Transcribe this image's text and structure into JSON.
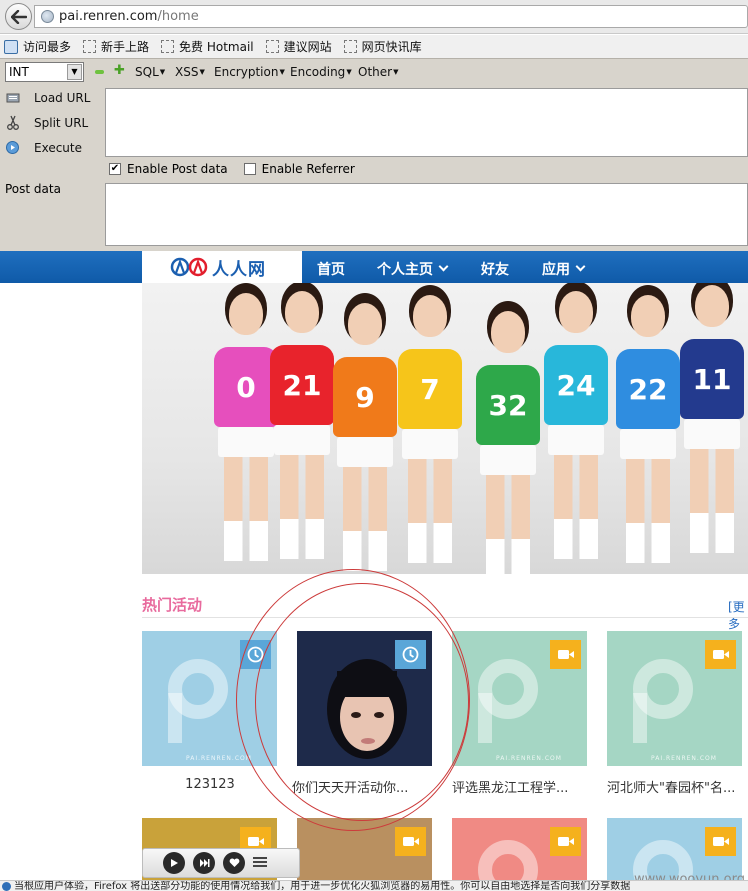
{
  "browser": {
    "url_host": "pai.renren.com",
    "url_path": "/home",
    "bookmarks": [
      "访问最多",
      "新手上路",
      "免费 Hotmail",
      "建议网站",
      "网页快讯库"
    ]
  },
  "hackbar": {
    "type_select": "INT",
    "menus": [
      "SQL",
      "XSS",
      "Encryption",
      "Encoding",
      "Other"
    ],
    "load_url": "Load URL",
    "split_url": "Split URL",
    "execute": "Execute",
    "enable_post": "Enable Post data",
    "enable_referrer": "Enable Referrer",
    "post_label": "Post data"
  },
  "renren": {
    "logo_text": "人人网",
    "nav": [
      "首页",
      "个人主页",
      "好友",
      "应用"
    ],
    "section_title": "热门活动",
    "more": "[更多",
    "cards": [
      {
        "label": "123123",
        "badge": "clock-icon",
        "color": "#9fcfe5"
      },
      {
        "label": "你们天天开活动你...",
        "badge": "clock-icon",
        "color": "#1e2a4a"
      },
      {
        "label": "评选黑龙江工程学...",
        "badge": "video-icon",
        "color": "#a5d6c4"
      },
      {
        "label": "河北师大\"春园杯\"名...",
        "badge": "video-icon",
        "color": "#a5d6c4"
      }
    ],
    "row2_colors": [
      "#c9a23a",
      "#b99060",
      "#f08a84",
      "#9fcfe5"
    ],
    "girls": [
      {
        "number": "0",
        "color": "#e64fbd"
      },
      {
        "number": "21",
        "color": "#e8232c"
      },
      {
        "number": "9",
        "color": "#f07a1a"
      },
      {
        "number": "7",
        "color": "#f6c51a"
      },
      {
        "number": "32",
        "color": "#2ea84a"
      },
      {
        "number": "24",
        "color": "#28b7da"
      },
      {
        "number": "22",
        "color": "#2f8de0"
      },
      {
        "number": "11",
        "color": "#233a8e"
      }
    ]
  },
  "status": {
    "text": "当根应用户体验，Firefox 将出送部分功能的使用情况给我们，用于进一步优化火狐浏览器的易用性。你可以自由地选择是否向我们分享数据",
    "watermark": "www.wooyun.org"
  }
}
